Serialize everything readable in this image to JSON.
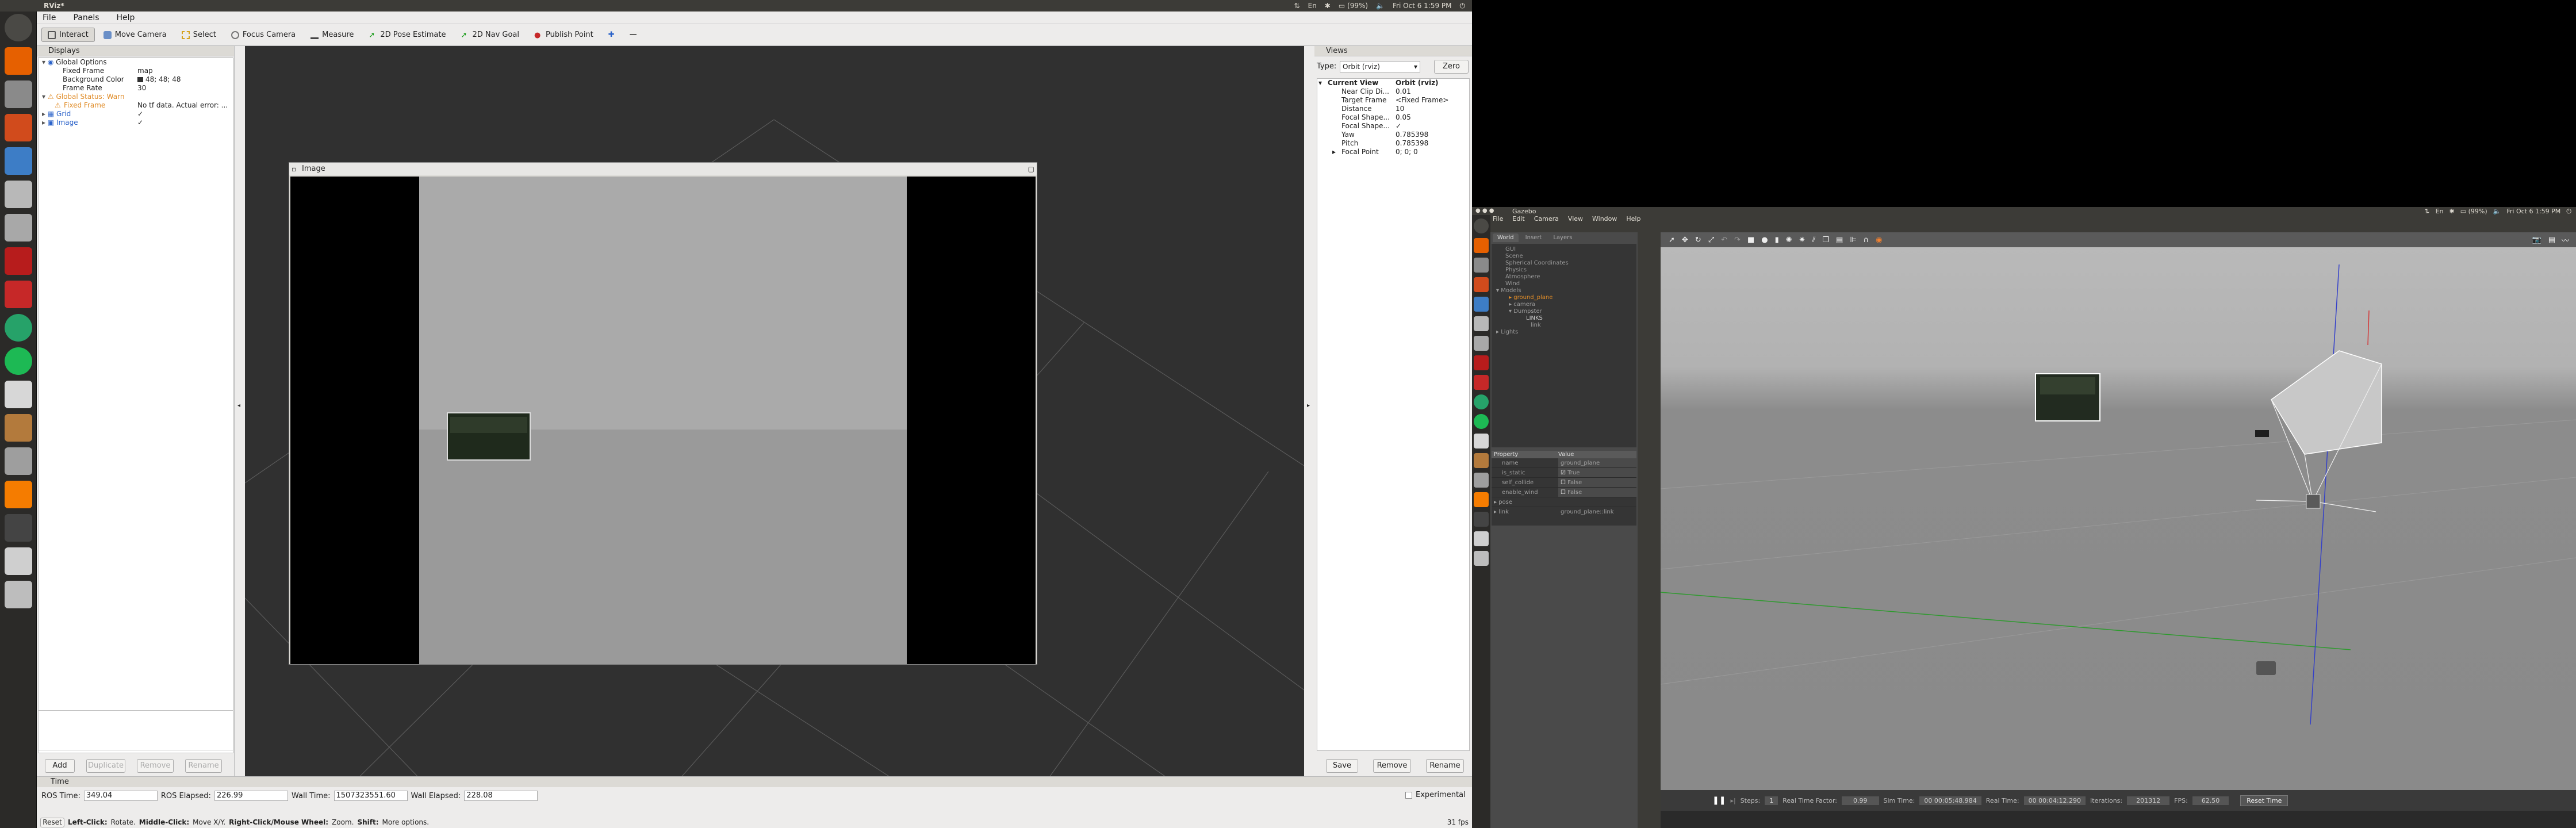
{
  "rviz": {
    "window_title": "RViz*",
    "clock": "Fri Oct 6  1:59 PM",
    "battery": "(99%)",
    "menu": [
      "File",
      "Panels",
      "Help"
    ],
    "tools": [
      {
        "label": "Interact",
        "icon": "interact-icon",
        "active": true
      },
      {
        "label": "Move Camera",
        "icon": "move-camera-icon"
      },
      {
        "label": "Select",
        "icon": "select-icon"
      },
      {
        "label": "Focus Camera",
        "icon": "focus-camera-icon"
      },
      {
        "label": "Measure",
        "icon": "measure-icon"
      },
      {
        "label": "2D Pose Estimate",
        "icon": "pose-estimate-icon"
      },
      {
        "label": "2D Nav Goal",
        "icon": "nav-goal-icon"
      },
      {
        "label": "Publish Point",
        "icon": "publish-point-icon"
      }
    ],
    "displays": {
      "title": "Displays",
      "rows": [
        {
          "name": "Global Options",
          "value": "",
          "level": 0,
          "kind": "header"
        },
        {
          "name": "Fixed Frame",
          "value": "map",
          "level": 1
        },
        {
          "name": "Background Color",
          "value": "48; 48; 48",
          "level": 1,
          "swatch": "#303030"
        },
        {
          "name": "Frame Rate",
          "value": "30",
          "level": 1
        },
        {
          "name": "Global Status: Warn",
          "value": "",
          "level": 0,
          "kind": "warn"
        },
        {
          "name": "Fixed Frame",
          "value": "No tf data.  Actual error: ...",
          "level": 1,
          "kind": "warn"
        },
        {
          "name": "Grid",
          "value": "✓",
          "level": 0,
          "kind": "display"
        },
        {
          "name": "Image",
          "value": "✓",
          "level": 0,
          "kind": "display"
        }
      ],
      "buttons": [
        "Add",
        "Duplicate",
        "Remove",
        "Rename"
      ]
    },
    "image_window_title": "Image",
    "views": {
      "title": "Views",
      "type_label": "Type:",
      "type_value": "Orbit (rviz)",
      "zero": "Zero",
      "rows": [
        {
          "name": "Current View",
          "value": "Orbit (rviz)",
          "bold": true
        },
        {
          "name": "Near Clip Di...",
          "value": "0.01"
        },
        {
          "name": "Target Frame",
          "value": "<Fixed Frame>"
        },
        {
          "name": "Distance",
          "value": "10"
        },
        {
          "name": "Focal Shape...",
          "value": "0.05"
        },
        {
          "name": "Focal Shape...",
          "value": "✓"
        },
        {
          "name": "Yaw",
          "value": "0.785398"
        },
        {
          "name": "Pitch",
          "value": "0.785398"
        },
        {
          "name": "Focal Point",
          "value": "0; 0; 0"
        }
      ],
      "buttons": [
        "Save",
        "Remove",
        "Rename"
      ]
    },
    "time": {
      "title": "Time",
      "ros_time_label": "ROS Time:",
      "ros_time": "349.04",
      "ros_elapsed_label": "ROS Elapsed:",
      "ros_elapsed": "226.99",
      "wall_time_label": "Wall Time:",
      "wall_time": "1507323551.60",
      "wall_elapsed_label": "Wall Elapsed:",
      "wall_elapsed": "228.08",
      "experimental": "Experimental"
    },
    "status": {
      "reset": "Reset",
      "hint_left": "Left-Click:",
      "hint_left_text": "Rotate.",
      "hint_mid": "Middle-Click:",
      "hint_mid_text": "Move X/Y.",
      "hint_right": "Right-Click/Mouse Wheel:",
      "hint_right_text": "Zoom.",
      "hint_shift": "Shift:",
      "hint_shift_text": "More options.",
      "fps": "31 fps"
    }
  },
  "gazebo": {
    "window_title": "Gazebo",
    "clock": "Fri Oct 6  1:59 PM",
    "battery": "(99%)",
    "menu": [
      "File",
      "Edit",
      "Camera",
      "View",
      "Window",
      "Help"
    ],
    "tabs": [
      "World",
      "Insert",
      "Layers"
    ],
    "world_tree": [
      {
        "label": "GUI",
        "level": 0
      },
      {
        "label": "Scene",
        "level": 0
      },
      {
        "label": "Spherical Coordinates",
        "level": 0
      },
      {
        "label": "Physics",
        "level": 0
      },
      {
        "label": "Atmosphere",
        "level": 0
      },
      {
        "label": "Wind",
        "level": 0
      },
      {
        "label": "Models",
        "level": 0,
        "expanded": true
      },
      {
        "label": "ground_plane",
        "level": 1,
        "color": "#e08c28"
      },
      {
        "label": "camera",
        "level": 1
      },
      {
        "label": "Dumpster",
        "level": 1,
        "expanded": true
      },
      {
        "label": "LINKS",
        "level": 2
      },
      {
        "label": "link",
        "level": 3
      },
      {
        "label": "Lights",
        "level": 0
      }
    ],
    "props_header": [
      "Property",
      "Value"
    ],
    "props": [
      {
        "name": "name",
        "value": "ground_plane"
      },
      {
        "name": "is_static",
        "value": "True",
        "check": true
      },
      {
        "name": "self_collide",
        "value": "False",
        "check": true
      },
      {
        "name": "enable_wind",
        "value": "False",
        "check": true
      },
      {
        "name": "pose",
        "value": "",
        "arrow": true
      },
      {
        "name": "link",
        "value": "ground_plane::link",
        "arrow": true
      }
    ],
    "bottom": {
      "steps_label": "Steps:",
      "steps": "1",
      "rtf_label": "Real Time Factor:",
      "rtf": "0.99",
      "sim_time_label": "Sim Time:",
      "sim_time": "00 00:05:48.984",
      "real_time_label": "Real Time:",
      "real_time": "00 00:04:12.290",
      "iterations_label": "Iterations:",
      "iterations": "201312",
      "fps_label": "FPS:",
      "fps": "62.50",
      "reset": "Reset Time"
    }
  }
}
